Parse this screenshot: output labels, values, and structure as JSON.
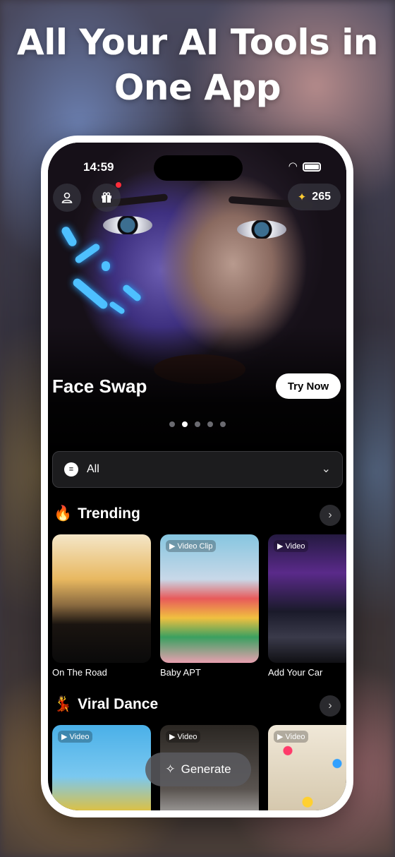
{
  "headline": {
    "line1": "All Your AI Tools in",
    "line2": "One App"
  },
  "status_bar": {
    "time": "14:59"
  },
  "header": {
    "credits": "265"
  },
  "hero": {
    "title": "Face Swap",
    "cta": "Try Now",
    "carousel_pages": 5,
    "active_page_index": 1
  },
  "filter": {
    "label": "All"
  },
  "sections": {
    "trending": {
      "emoji": "🔥",
      "title": "Trending",
      "items": [
        {
          "label": "On The Road",
          "tag": ""
        },
        {
          "label": "Baby APT",
          "tag": "▶ Video Clip"
        },
        {
          "label": "Add Your Car",
          "tag": "▶ Video"
        }
      ]
    },
    "viral_dance": {
      "emoji": "💃",
      "title": "Viral Dance",
      "items": [
        {
          "tag": "▶ Video"
        },
        {
          "tag": "▶ Video"
        },
        {
          "tag": "▶ Video"
        }
      ]
    }
  },
  "generate_button": {
    "icon": "sparkle-icon",
    "label": "Generate"
  },
  "colors": {
    "screen_bg": "#000000",
    "notification_dot": "#ff2d3a",
    "credits_icon": "#ffcc33"
  }
}
